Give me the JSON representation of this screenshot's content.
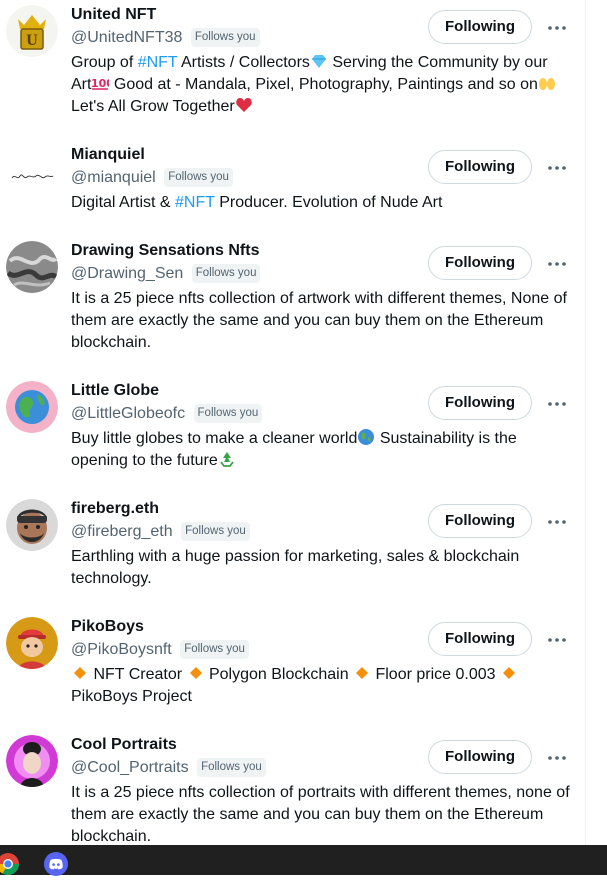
{
  "users": [
    {
      "name": "United NFT",
      "handle": "@UnitedNFT38",
      "follows_you": "Follows you",
      "button": "Following",
      "bio": {
        "a": "Group of ",
        "tag": "#NFT",
        "b": " Artists / Collectors",
        "c": " Serving the Community by our Art",
        "d": " Good at - Mandala, Pixel, Photography, Paintings and so on",
        "e": " Let's All Grow Together"
      }
    },
    {
      "name": "Mianquiel",
      "handle": "@mianquiel",
      "follows_you": "Follows you",
      "button": "Following",
      "avatar_text": "Mianquiel",
      "bio": {
        "a": "Digital Artist & ",
        "tag": "#NFT",
        "b": " Producer. Evolution of Nude Art"
      }
    },
    {
      "name": "Drawing Sensations Nfts",
      "handle": "@Drawing_Sen",
      "follows_you": "Follows you",
      "button": "Following",
      "bio": "It is a 25 piece nfts collection of artwork with different themes, None of them are exactly the same and you can buy them on the Ethereum blockchain."
    },
    {
      "name": "Little Globe",
      "handle": "@LittleGlobeofc",
      "follows_you": "Follows you",
      "button": "Following",
      "bio": {
        "a": "Buy little globes to make a cleaner world",
        "b": " Sustainability is the opening to the future"
      }
    },
    {
      "name": "fireberg.eth",
      "handle": "@fireberg_eth",
      "follows_you": "Follows you",
      "button": "Following",
      "bio": "Earthling with a huge passion for marketing, sales & blockchain technology."
    },
    {
      "name": "PikoBoys",
      "handle": "@PikoBoysnft",
      "follows_you": "Follows you",
      "button": "Following",
      "bio": {
        "a": " NFT Creator ",
        "b": " Polygon Blockchain ",
        "c": " Floor price 0.003 ",
        "d": " PikoBoys Project"
      }
    },
    {
      "name": "Cool Portraits",
      "handle": "@Cool_Portraits",
      "follows_you": "Follows you",
      "button": "Following",
      "bio": "It is a 25 piece nfts collection of portraits with different themes, none of them are exactly the same and you can buy them on the Ethereum blockchain."
    }
  ],
  "colors": {
    "link": "#1d9bf0",
    "secondary_text": "#536471",
    "badge_bg": "#eff3f4",
    "button_border": "#cfd9de",
    "taskbar": "#202020"
  },
  "icons": {
    "more": "more-dots-icon",
    "taskbar": [
      "chrome-icon",
      "discord-icon"
    ]
  }
}
